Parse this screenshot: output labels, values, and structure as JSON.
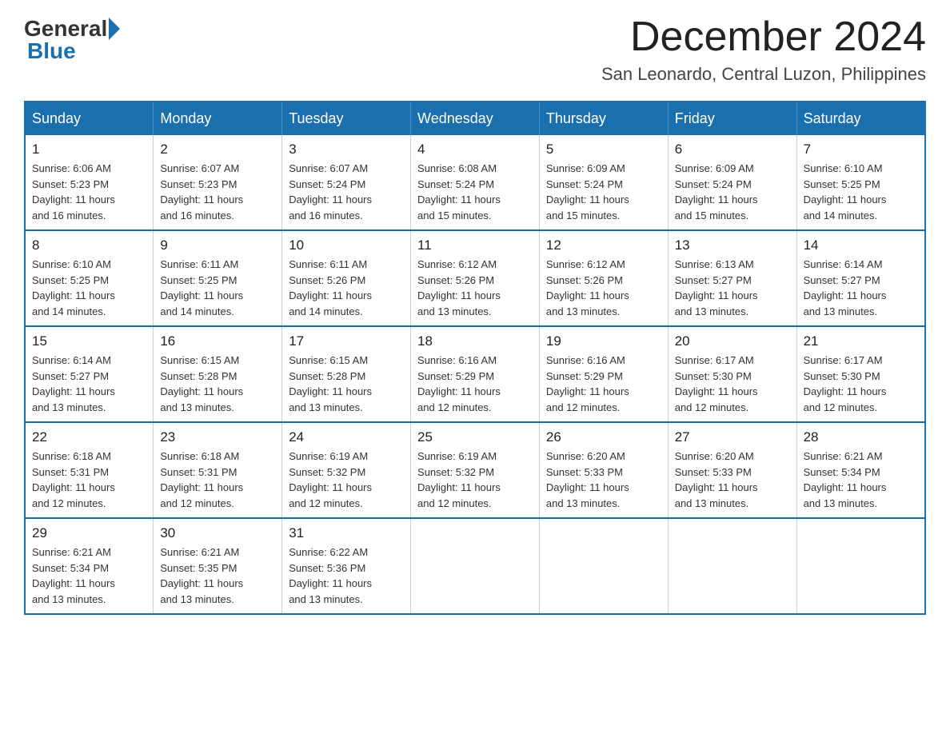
{
  "header": {
    "logo": {
      "general": "General",
      "blue": "Blue"
    },
    "title": "December 2024",
    "subtitle": "San Leonardo, Central Luzon, Philippines"
  },
  "calendar": {
    "days_of_week": [
      "Sunday",
      "Monday",
      "Tuesday",
      "Wednesday",
      "Thursday",
      "Friday",
      "Saturday"
    ],
    "weeks": [
      [
        {
          "day": "1",
          "sunrise": "6:06 AM",
          "sunset": "5:23 PM",
          "daylight": "11 hours and 16 minutes."
        },
        {
          "day": "2",
          "sunrise": "6:07 AM",
          "sunset": "5:23 PM",
          "daylight": "11 hours and 16 minutes."
        },
        {
          "day": "3",
          "sunrise": "6:07 AM",
          "sunset": "5:24 PM",
          "daylight": "11 hours and 16 minutes."
        },
        {
          "day": "4",
          "sunrise": "6:08 AM",
          "sunset": "5:24 PM",
          "daylight": "11 hours and 15 minutes."
        },
        {
          "day": "5",
          "sunrise": "6:09 AM",
          "sunset": "5:24 PM",
          "daylight": "11 hours and 15 minutes."
        },
        {
          "day": "6",
          "sunrise": "6:09 AM",
          "sunset": "5:24 PM",
          "daylight": "11 hours and 15 minutes."
        },
        {
          "day": "7",
          "sunrise": "6:10 AM",
          "sunset": "5:25 PM",
          "daylight": "11 hours and 14 minutes."
        }
      ],
      [
        {
          "day": "8",
          "sunrise": "6:10 AM",
          "sunset": "5:25 PM",
          "daylight": "11 hours and 14 minutes."
        },
        {
          "day": "9",
          "sunrise": "6:11 AM",
          "sunset": "5:25 PM",
          "daylight": "11 hours and 14 minutes."
        },
        {
          "day": "10",
          "sunrise": "6:11 AM",
          "sunset": "5:26 PM",
          "daylight": "11 hours and 14 minutes."
        },
        {
          "day": "11",
          "sunrise": "6:12 AM",
          "sunset": "5:26 PM",
          "daylight": "11 hours and 13 minutes."
        },
        {
          "day": "12",
          "sunrise": "6:12 AM",
          "sunset": "5:26 PM",
          "daylight": "11 hours and 13 minutes."
        },
        {
          "day": "13",
          "sunrise": "6:13 AM",
          "sunset": "5:27 PM",
          "daylight": "11 hours and 13 minutes."
        },
        {
          "day": "14",
          "sunrise": "6:14 AM",
          "sunset": "5:27 PM",
          "daylight": "11 hours and 13 minutes."
        }
      ],
      [
        {
          "day": "15",
          "sunrise": "6:14 AM",
          "sunset": "5:27 PM",
          "daylight": "11 hours and 13 minutes."
        },
        {
          "day": "16",
          "sunrise": "6:15 AM",
          "sunset": "5:28 PM",
          "daylight": "11 hours and 13 minutes."
        },
        {
          "day": "17",
          "sunrise": "6:15 AM",
          "sunset": "5:28 PM",
          "daylight": "11 hours and 13 minutes."
        },
        {
          "day": "18",
          "sunrise": "6:16 AM",
          "sunset": "5:29 PM",
          "daylight": "11 hours and 12 minutes."
        },
        {
          "day": "19",
          "sunrise": "6:16 AM",
          "sunset": "5:29 PM",
          "daylight": "11 hours and 12 minutes."
        },
        {
          "day": "20",
          "sunrise": "6:17 AM",
          "sunset": "5:30 PM",
          "daylight": "11 hours and 12 minutes."
        },
        {
          "day": "21",
          "sunrise": "6:17 AM",
          "sunset": "5:30 PM",
          "daylight": "11 hours and 12 minutes."
        }
      ],
      [
        {
          "day": "22",
          "sunrise": "6:18 AM",
          "sunset": "5:31 PM",
          "daylight": "11 hours and 12 minutes."
        },
        {
          "day": "23",
          "sunrise": "6:18 AM",
          "sunset": "5:31 PM",
          "daylight": "11 hours and 12 minutes."
        },
        {
          "day": "24",
          "sunrise": "6:19 AM",
          "sunset": "5:32 PM",
          "daylight": "11 hours and 12 minutes."
        },
        {
          "day": "25",
          "sunrise": "6:19 AM",
          "sunset": "5:32 PM",
          "daylight": "11 hours and 12 minutes."
        },
        {
          "day": "26",
          "sunrise": "6:20 AM",
          "sunset": "5:33 PM",
          "daylight": "11 hours and 13 minutes."
        },
        {
          "day": "27",
          "sunrise": "6:20 AM",
          "sunset": "5:33 PM",
          "daylight": "11 hours and 13 minutes."
        },
        {
          "day": "28",
          "sunrise": "6:21 AM",
          "sunset": "5:34 PM",
          "daylight": "11 hours and 13 minutes."
        }
      ],
      [
        {
          "day": "29",
          "sunrise": "6:21 AM",
          "sunset": "5:34 PM",
          "daylight": "11 hours and 13 minutes."
        },
        {
          "day": "30",
          "sunrise": "6:21 AM",
          "sunset": "5:35 PM",
          "daylight": "11 hours and 13 minutes."
        },
        {
          "day": "31",
          "sunrise": "6:22 AM",
          "sunset": "5:36 PM",
          "daylight": "11 hours and 13 minutes."
        },
        null,
        null,
        null,
        null
      ]
    ],
    "sunrise_label": "Sunrise:",
    "sunset_label": "Sunset:",
    "daylight_label": "Daylight:"
  }
}
